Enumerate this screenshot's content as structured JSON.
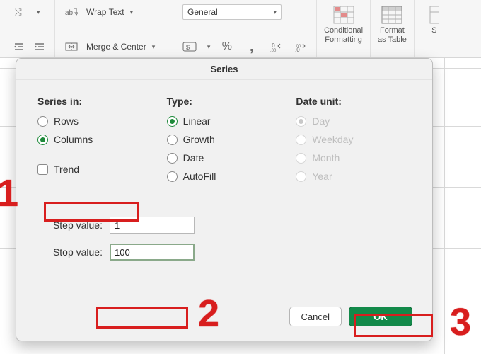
{
  "ribbon": {
    "wrap_label": "Wrap Text",
    "merge_label": "Merge & Center",
    "format_combo": "General",
    "cond_fmt_line1": "Conditional",
    "cond_fmt_line2": "Formatting",
    "fmt_table_line1": "Format",
    "fmt_table_line2": "as Table",
    "styles_line1": "S"
  },
  "dialog": {
    "title": "Series",
    "series_in_label": "Series in:",
    "rows_label": "Rows",
    "columns_label": "Columns",
    "trend_label": "Trend",
    "type_label": "Type:",
    "type_linear": "Linear",
    "type_growth": "Growth",
    "type_date": "Date",
    "type_autofill": "AutoFill",
    "dateunit_label": "Date unit:",
    "du_day": "Day",
    "du_weekday": "Weekday",
    "du_month": "Month",
    "du_year": "Year",
    "step_label": "Step value:",
    "step_value": "1",
    "stop_label": "Stop value:",
    "stop_value": "100",
    "cancel": "Cancel",
    "ok": "OK"
  },
  "annotations": {
    "n1": "1",
    "n2": "2",
    "n3": "3"
  }
}
